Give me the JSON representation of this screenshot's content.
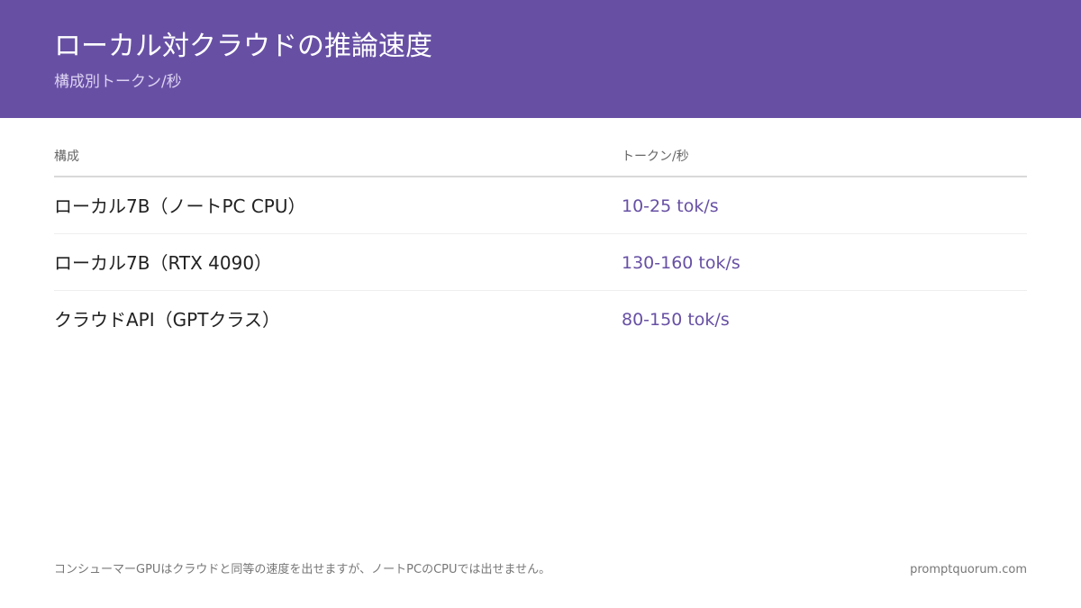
{
  "header": {
    "title": "ローカル対クラウドの推論速度",
    "subtitle": "構成別トークン/秒"
  },
  "table": {
    "columns": [
      "構成",
      "トークン/秒"
    ],
    "rows": [
      {
        "config": "ローカル7B（ノートPC CPU）",
        "speed": "10-25 tok/s"
      },
      {
        "config": "ローカル7B（RTX 4090）",
        "speed": "130-160 tok/s"
      },
      {
        "config": "クラウドAPI（GPTクラス）",
        "speed": "80-150 tok/s"
      }
    ]
  },
  "footer": {
    "note": "コンシューマーGPUはクラウドと同等の速度を出せますが、ノートPCのCPUでは出せません。",
    "source": "promptquorum.com"
  },
  "colors": {
    "accent": "#6750a4",
    "header_text": "#ffffff",
    "subtitle_text": "#ddd3f2"
  }
}
